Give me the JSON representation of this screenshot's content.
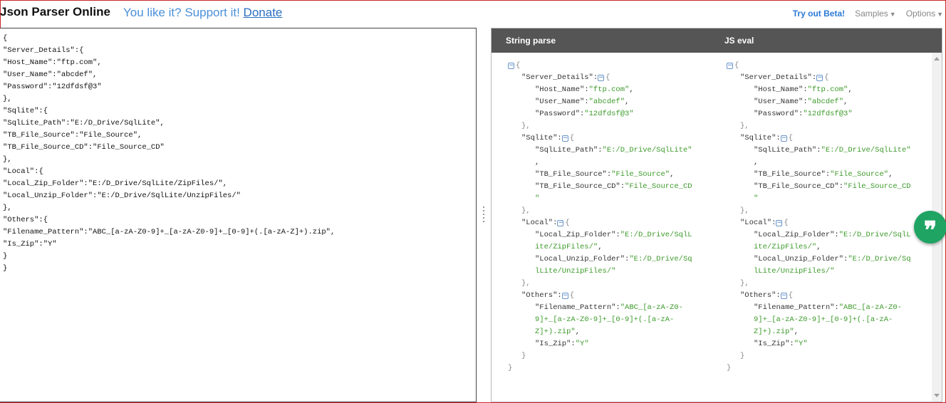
{
  "header": {
    "app_title": "Json Parser Online",
    "support_text": "You like it? Support it!",
    "donate_label": "Donate",
    "beta_label": "Try out Beta!",
    "samples_label": "Samples",
    "options_label": "Options"
  },
  "editor": {
    "lines": [
      "{",
      "\"Server_Details\":{",
      "\"Host_Name\":\"ftp.com\",",
      "\"User_Name\":\"abcdef\",",
      "\"Password\":\"12dfdsf@3\"",
      "},",
      "\"Sqlite\":{",
      "\"SqlLite_Path\":\"E:/D_Drive/SqlLite\",",
      "\"TB_File_Source\":\"File_Source\",",
      "\"TB_File_Source_CD\":\"File_Source_CD\"",
      "},",
      "\"Local\":{",
      "\"Local_Zip_Folder\":\"E:/D_Drive/SqlLite/ZipFiles/\",",
      "\"Local_Unzip_Folder\":\"E:/D_Drive/SqlLite/UnzipFiles/\"",
      "},",
      "\"Others\":{",
      "\"Filename_Pattern\":\"ABC_[a-zA-Z0-9]+_[a-zA-Z0-9]+_[0-9]+(.[a-zA-Z]+).zip\",",
      "\"Is_Zip\":\"Y\"",
      "}",
      "}"
    ]
  },
  "output": {
    "left_heading": "String parse",
    "right_heading": "JS eval",
    "tree_lines": [
      {
        "indent": 0,
        "toggle": true,
        "parts": [
          [
            "brace",
            "{"
          ]
        ]
      },
      {
        "indent": 1,
        "toggle": false,
        "parts": [
          [
            "key",
            "\"Server_Details\""
          ],
          [
            "punc",
            ":"
          ]
        ],
        "toggle_after": true,
        "tail": [
          [
            "brace",
            "{"
          ]
        ]
      },
      {
        "indent": 2,
        "toggle": false,
        "parts": [
          [
            "key",
            "\"Host_Name\""
          ],
          [
            "punc",
            ":"
          ],
          [
            "str",
            "\"ftp.com\""
          ],
          [
            "punc",
            ","
          ]
        ]
      },
      {
        "indent": 2,
        "toggle": false,
        "parts": [
          [
            "key",
            "\"User_Name\""
          ],
          [
            "punc",
            ":"
          ],
          [
            "str",
            "\"abcdef\""
          ],
          [
            "punc",
            ","
          ]
        ]
      },
      {
        "indent": 2,
        "toggle": false,
        "parts": [
          [
            "key",
            "\"Password\""
          ],
          [
            "punc",
            ":"
          ],
          [
            "str",
            "\"12dfdsf@3\""
          ]
        ]
      },
      {
        "indent": 1,
        "toggle": false,
        "parts": [
          [
            "brace",
            "},"
          ]
        ]
      },
      {
        "indent": 1,
        "toggle": false,
        "parts": [
          [
            "key",
            "\"Sqlite\""
          ],
          [
            "punc",
            ":"
          ]
        ],
        "toggle_after": true,
        "tail": [
          [
            "brace",
            "{"
          ]
        ]
      },
      {
        "indent": 2,
        "toggle": false,
        "parts": [
          [
            "key",
            "\"SqlLite_Path\""
          ],
          [
            "punc",
            ":"
          ],
          [
            "str",
            "\"E:/D_Drive/SqlLite\""
          ]
        ]
      },
      {
        "indent": 2,
        "toggle": false,
        "parts": [
          [
            "punc",
            ","
          ]
        ]
      },
      {
        "indent": 2,
        "toggle": false,
        "parts": [
          [
            "key",
            "\"TB_File_Source\""
          ],
          [
            "punc",
            ":"
          ],
          [
            "str",
            "\"File_Source\""
          ],
          [
            "punc",
            ","
          ]
        ]
      },
      {
        "indent": 2,
        "toggle": false,
        "parts": [
          [
            "key",
            "\"TB_File_Source_CD\""
          ],
          [
            "punc",
            ":"
          ],
          [
            "str",
            "\"File_Source_CD"
          ]
        ]
      },
      {
        "indent": 2,
        "toggle": false,
        "parts": [
          [
            "str",
            "\""
          ]
        ]
      },
      {
        "indent": 1,
        "toggle": false,
        "parts": [
          [
            "brace",
            "},"
          ]
        ]
      },
      {
        "indent": 1,
        "toggle": false,
        "parts": [
          [
            "key",
            "\"Local\""
          ],
          [
            "punc",
            ":"
          ]
        ],
        "toggle_after": true,
        "tail": [
          [
            "brace",
            "{"
          ]
        ]
      },
      {
        "indent": 2,
        "toggle": false,
        "parts": [
          [
            "key",
            "\"Local_Zip_Folder\""
          ],
          [
            "punc",
            ":"
          ],
          [
            "str",
            "\"E:/D_Drive/SqlL"
          ]
        ]
      },
      {
        "indent": 2,
        "toggle": false,
        "parts": [
          [
            "str",
            "ite/ZipFiles/\""
          ],
          [
            "punc",
            ","
          ]
        ]
      },
      {
        "indent": 2,
        "toggle": false,
        "parts": [
          [
            "key",
            "\"Local_Unzip_Folder\""
          ],
          [
            "punc",
            ":"
          ],
          [
            "str",
            "\"E:/D_Drive/Sq"
          ]
        ]
      },
      {
        "indent": 2,
        "toggle": false,
        "parts": [
          [
            "str",
            "lLite/UnzipFiles/\""
          ]
        ]
      },
      {
        "indent": 1,
        "toggle": false,
        "parts": [
          [
            "brace",
            "},"
          ]
        ]
      },
      {
        "indent": 1,
        "toggle": false,
        "parts": [
          [
            "key",
            "\"Others\""
          ],
          [
            "punc",
            ":"
          ]
        ],
        "toggle_after": true,
        "tail": [
          [
            "brace",
            "{"
          ]
        ]
      },
      {
        "indent": 2,
        "toggle": false,
        "parts": [
          [
            "key",
            "\"Filename_Pattern\""
          ],
          [
            "punc",
            ":"
          ],
          [
            "str",
            "\"ABC_[a-zA-Z0-"
          ]
        ]
      },
      {
        "indent": 2,
        "toggle": false,
        "parts": [
          [
            "str",
            "9]+_[a-zA-Z0-9]+_[0-9]+(.[a-zA-"
          ]
        ]
      },
      {
        "indent": 2,
        "toggle": false,
        "parts": [
          [
            "str",
            "Z]+).zip\""
          ],
          [
            "punc",
            ","
          ]
        ]
      },
      {
        "indent": 2,
        "toggle": false,
        "parts": [
          [
            "key",
            "\"Is_Zip\""
          ],
          [
            "punc",
            ":"
          ],
          [
            "str",
            "\"Y\""
          ]
        ]
      },
      {
        "indent": 1,
        "toggle": false,
        "parts": [
          [
            "brace",
            "}"
          ]
        ]
      },
      {
        "indent": 0,
        "toggle": false,
        "parts": [
          [
            "brace",
            "}"
          ]
        ]
      }
    ]
  },
  "icons": {
    "toggle": "collapse-minus-icon",
    "fab": "quote-icon"
  },
  "colors": {
    "header_bar": "#555555",
    "string_value": "#3d9a2b",
    "fab": "#1fa463",
    "link": "#2a7ad6"
  }
}
